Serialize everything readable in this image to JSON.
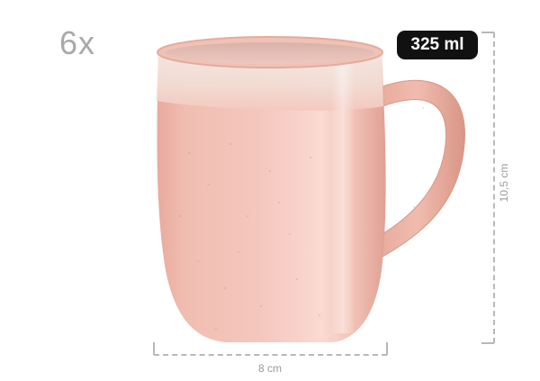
{
  "product": {
    "quantity_label": "6x",
    "volume_label": "325 ml",
    "colors": {
      "glaze": "#f2c3b9",
      "rim_white": "#f3e6df",
      "badge_bg": "#111111",
      "dimension_line": "#b8b8b8"
    }
  },
  "dimensions": {
    "height_label": "10,5 cm",
    "width_label": "8 cm"
  }
}
